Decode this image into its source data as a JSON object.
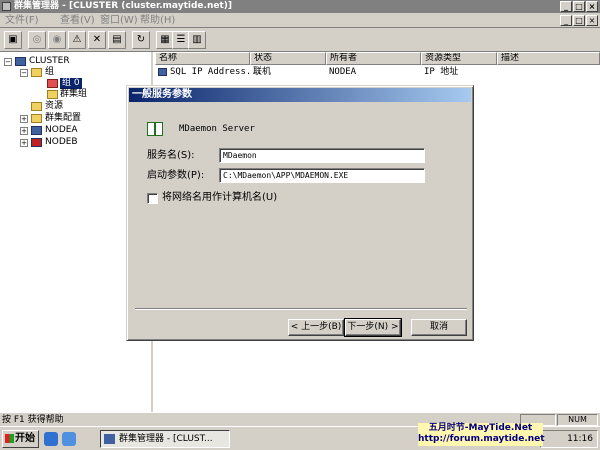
{
  "window": {
    "title": "群集管理器 - [CLUSTER (cluster.maytide.net)]"
  },
  "menu": {
    "items": [
      "文件(F)",
      "查看(V)",
      "窗口(W)",
      "帮助(H)"
    ]
  },
  "tree": {
    "root": "CLUSTER",
    "groups": "组",
    "group0": "组 0",
    "cluster_group": "群集组",
    "resources": "资源",
    "cluster_config": "群集配置",
    "node_a": "NODEA",
    "node_b": "NODEB"
  },
  "list": {
    "columns": [
      "名称",
      "状态",
      "所有者",
      "资源类型",
      "描述"
    ],
    "rows": [
      [
        "SQL IP Address...",
        "联机",
        "NODEA",
        "IP 地址",
        ""
      ]
    ]
  },
  "dialog": {
    "title": "一般服务参数",
    "app_name": "MDaemon Server",
    "service_name_label": "服务名(S):",
    "service_name_value": "MDaemon",
    "start_params_label": "启动参数(P):",
    "start_params_value": "C:\\MDaemon\\APP\\MDAEMON.EXE",
    "use_network_name_label": "将网络名用作计算机名(U)",
    "back_button": "< 上一步(B)",
    "next_button": "下一步(N) >",
    "cancel_button": "取消"
  },
  "status": {
    "help_text": "按 F1 获得帮助",
    "num": "NUM"
  },
  "taskbar": {
    "start_label": "开始",
    "task_label": "群集管理器 - [CLUST...",
    "clock": "11:16"
  },
  "watermark": {
    "line1": "五月时节-MayTide.Net",
    "line2": "http://forum.maytide.net"
  }
}
